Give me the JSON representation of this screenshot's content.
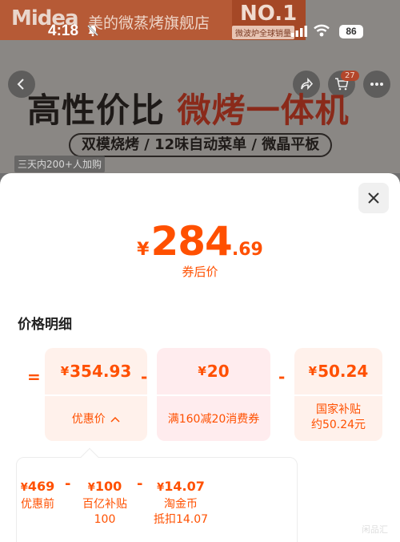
{
  "status_bar": {
    "time": "4:18",
    "battery": "86"
  },
  "banner": {
    "brand_logo": "Midea",
    "store_name": "美的微蒸烤旗舰店",
    "rank_badge": "NO.1",
    "rank_note": "微波炉全球销量",
    "headline_part1": "高性价比",
    "headline_part2": "微烤一体机",
    "subline": "双模烧烤 / 12味自动菜单 / 微晶平板",
    "buyers_note": "三天内200+人加购",
    "cart_count": "27"
  },
  "nav": {
    "icons": [
      "back-icon",
      "share-icon",
      "cart-icon",
      "more-icon"
    ]
  },
  "sheet": {
    "price": {
      "currency": "¥",
      "integer": "284",
      "decimal": ".69",
      "label": "券后价"
    },
    "section_title": "价格明细",
    "formula": {
      "equals": "=",
      "minus": "-",
      "cards": [
        {
          "currency": "¥",
          "value": "354.93",
          "label": "优惠价",
          "toggle_icon": "chevron-up-icon"
        },
        {
          "currency": "¥",
          "value": "20",
          "label": "满160减20消费券"
        },
        {
          "currency": "¥",
          "value": "50.24",
          "label_line1": "国家补贴",
          "label_line2": "约50.24元"
        }
      ]
    },
    "breakdown": [
      {
        "currency": "¥",
        "value": "469",
        "label_line1": "优惠前",
        "label_line2": ""
      },
      {
        "currency": "¥",
        "value": "100",
        "label_line1": "百亿补贴",
        "label_line2": "100"
      },
      {
        "currency": "¥",
        "value": "14.07",
        "label_line1": "淘金币",
        "label_line2": "抵扣14.07"
      }
    ],
    "watermark": "闲品汇"
  },
  "colors": {
    "accent": "#ff5000",
    "card_bg": "#fff1eb",
    "coupon_bg": "#ffecee"
  }
}
